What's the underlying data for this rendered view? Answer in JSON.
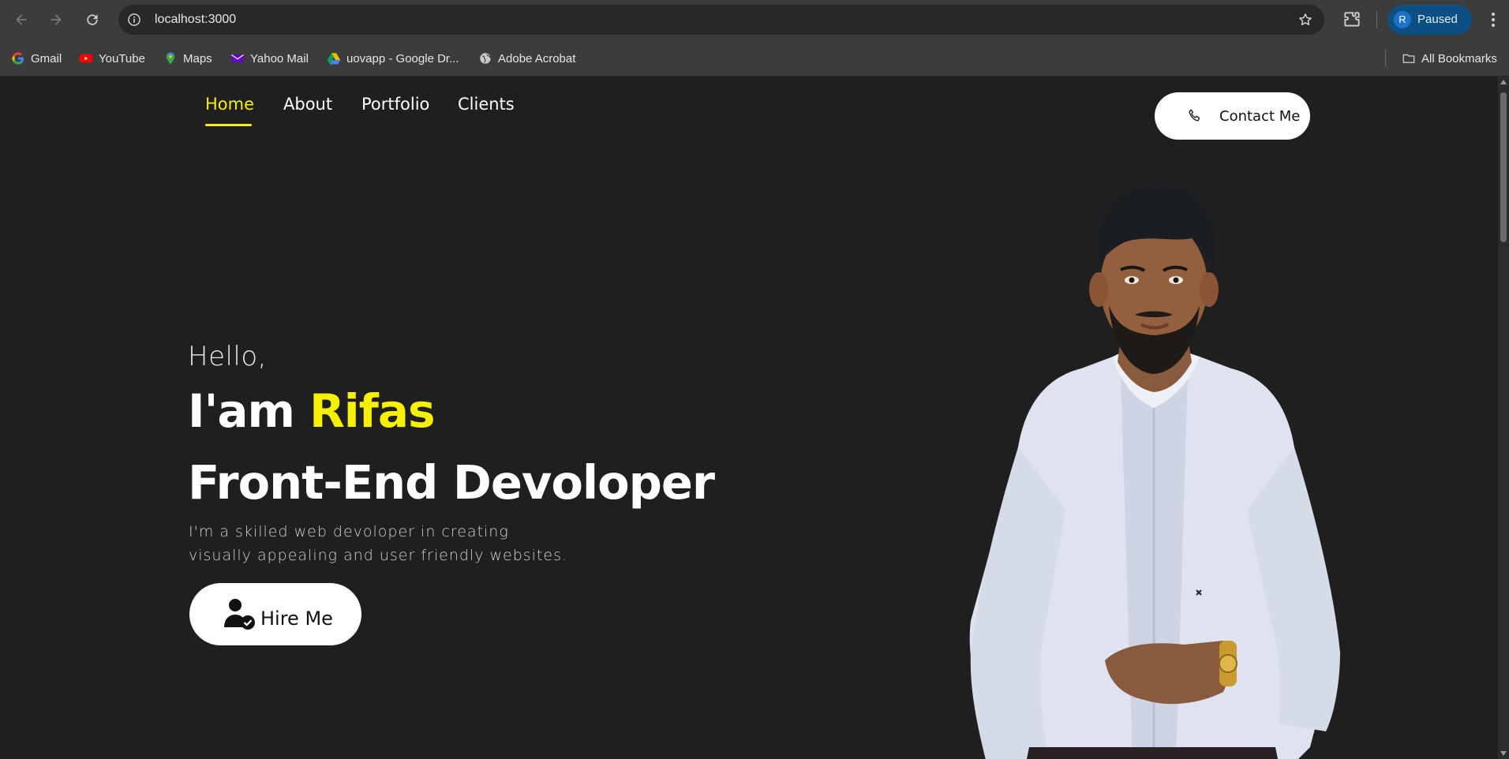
{
  "browser": {
    "url": "localhost:3000",
    "profile_initial": "R",
    "profile_label": "Paused",
    "bookmarks": [
      {
        "label": "Gmail",
        "icon": "google-icon"
      },
      {
        "label": "YouTube",
        "icon": "youtube-icon"
      },
      {
        "label": "Maps",
        "icon": "maps-icon"
      },
      {
        "label": "Yahoo Mail",
        "icon": "yahoo-mail-icon"
      },
      {
        "label": "uovapp - Google Dr...",
        "icon": "google-drive-icon"
      },
      {
        "label": "Adobe Acrobat",
        "icon": "globe-icon"
      }
    ],
    "all_bookmarks": "All Bookmarks"
  },
  "site": {
    "nav": [
      {
        "label": "Home",
        "active": true
      },
      {
        "label": "About"
      },
      {
        "label": "Portfolio"
      },
      {
        "label": "Clients"
      }
    ],
    "contact_label": "Contact Me",
    "hero": {
      "greeting": "Hello,",
      "intro": "I'am ",
      "name": "Rifas",
      "role": "Front-End Devoloper",
      "description_line1": "I'm a skilled web devoloper in creating",
      "description_line2": "visually appealing and user friendly websites.",
      "cta_label": "Hire Me"
    }
  },
  "colors": {
    "accent": "#f7f100",
    "background": "#1f1f1f",
    "button_bg": "#ffffff"
  }
}
